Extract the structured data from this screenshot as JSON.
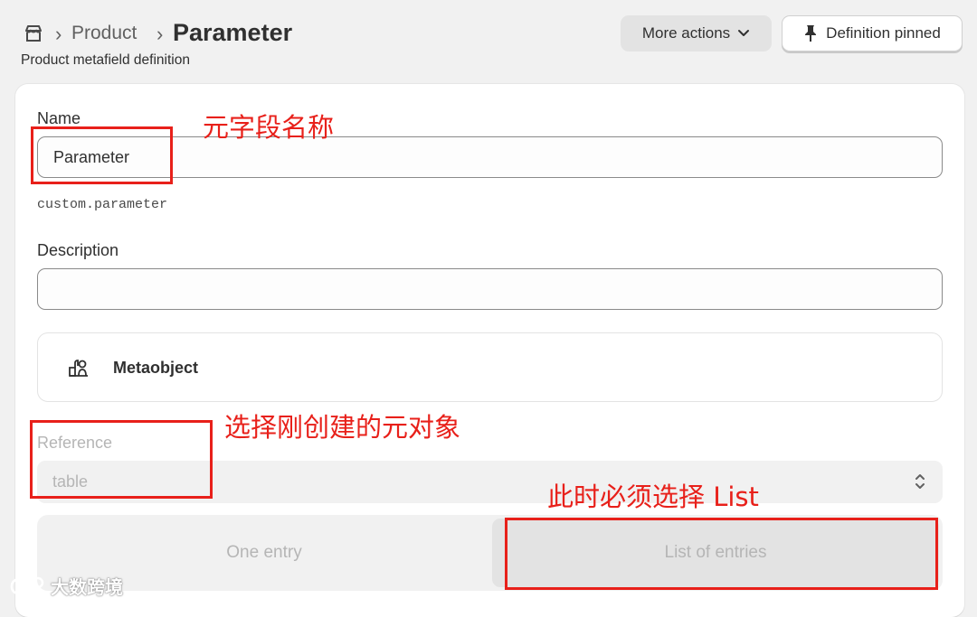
{
  "header": {
    "breadcrumb_parent": "Product",
    "separator": "›",
    "title": "Parameter",
    "subtitle": "Product metafield definition",
    "more_actions_label": "More actions",
    "pinned_label": "Definition pinned"
  },
  "form": {
    "name_label": "Name",
    "name_value": "Parameter",
    "namespace_key": "custom.parameter",
    "description_label": "Description",
    "description_value": "",
    "type_label": "Metaobject",
    "reference_label": "Reference",
    "reference_value": "table",
    "option_one": "One entry",
    "option_list": "List of entries"
  },
  "annotations": {
    "name_note": "元字段名称",
    "reference_note": "选择刚创建的元对象",
    "list_note": "此时必须选择 List"
  },
  "watermark": "大数跨境",
  "colors": {
    "annotation": "#e8201a",
    "disabled_text": "#b5b5b5",
    "card": "#ffffff",
    "page": "#f1f1f1"
  }
}
